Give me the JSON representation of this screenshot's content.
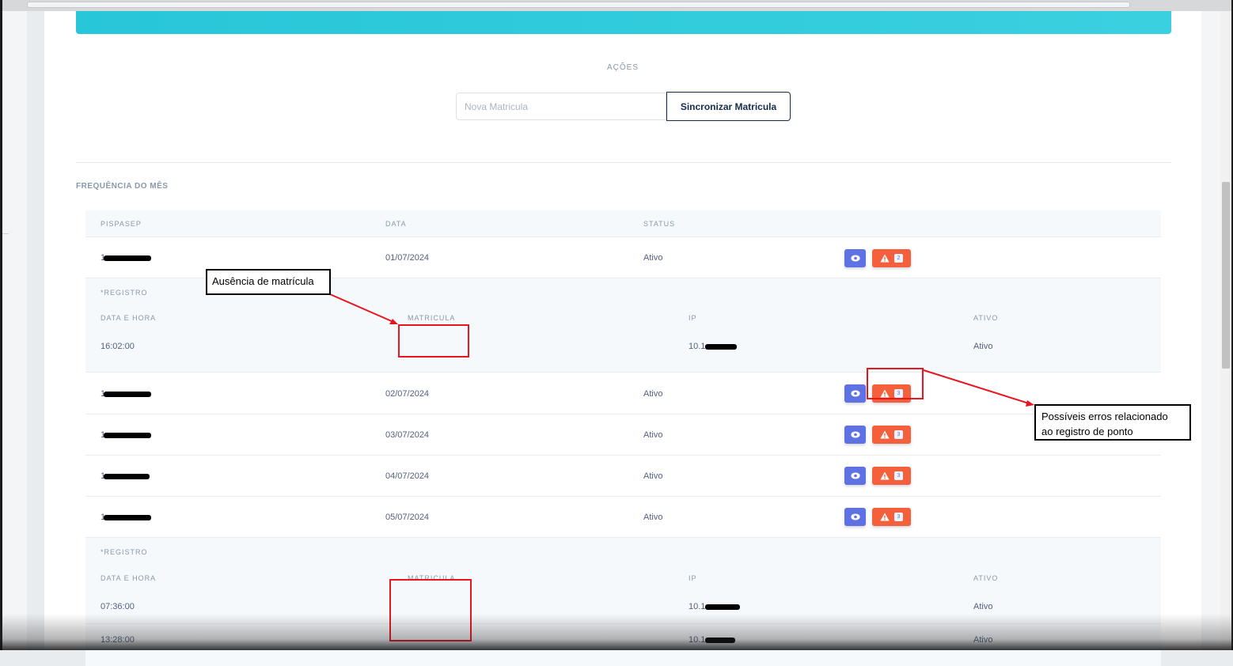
{
  "actions": {
    "title": "AÇÕES",
    "input_placeholder": "Nova Matricula",
    "sync_button": "Sincronizar Matricula"
  },
  "section_title": "FREQUÊNCIA DO MÊS",
  "table": {
    "headers": {
      "pispasep": "PISPASEP",
      "data": "DATA",
      "status": "STATUS"
    },
    "rows": [
      {
        "pis_visible": "1",
        "data": "01/07/2024",
        "status": "Ativo",
        "error_count": "2"
      },
      {
        "pis_visible": "1",
        "data": "02/07/2024",
        "status": "Ativo",
        "error_count": "3"
      },
      {
        "pis_visible": "1",
        "data": "03/07/2024",
        "status": "Ativo",
        "error_count": "3"
      },
      {
        "pis_visible": "1",
        "data": "04/07/2024",
        "status": "Ativo",
        "error_count": "3"
      },
      {
        "pis_visible": "1",
        "data": "05/07/2024",
        "status": "Ativo",
        "error_count": "3"
      }
    ],
    "sub_headers": {
      "registro": "*REGISTRO",
      "data_hora": "DATA E HORA",
      "matricula": "MATRICULA",
      "ip": "IP",
      "ativo": "ATIVO"
    },
    "registros_1": [
      {
        "hora": "16:02:00",
        "matricula": "",
        "ip_visible": "10.1",
        "ativo": "Ativo"
      }
    ],
    "registros_5": [
      {
        "hora": "07:36:00",
        "matricula": "",
        "ip_visible": "10.1",
        "ativo": "Ativo"
      },
      {
        "hora": "13:28:00",
        "matricula": "",
        "ip_visible": "10.1",
        "ativo": "Ativo"
      }
    ]
  },
  "annotations": {
    "missing_matricula": "Ausência de matrícula",
    "possible_errors_line1": "Possíveis erros relacionado",
    "possible_errors_line2": "ao registro de ponto"
  },
  "colors": {
    "banner": "#2fcbdc",
    "eye_button": "#5e72e4",
    "warn_button": "#f5603c",
    "annotation_red": "#e8161f"
  },
  "icons": {
    "view": "eye-icon",
    "warning": "warning-triangle-icon"
  }
}
